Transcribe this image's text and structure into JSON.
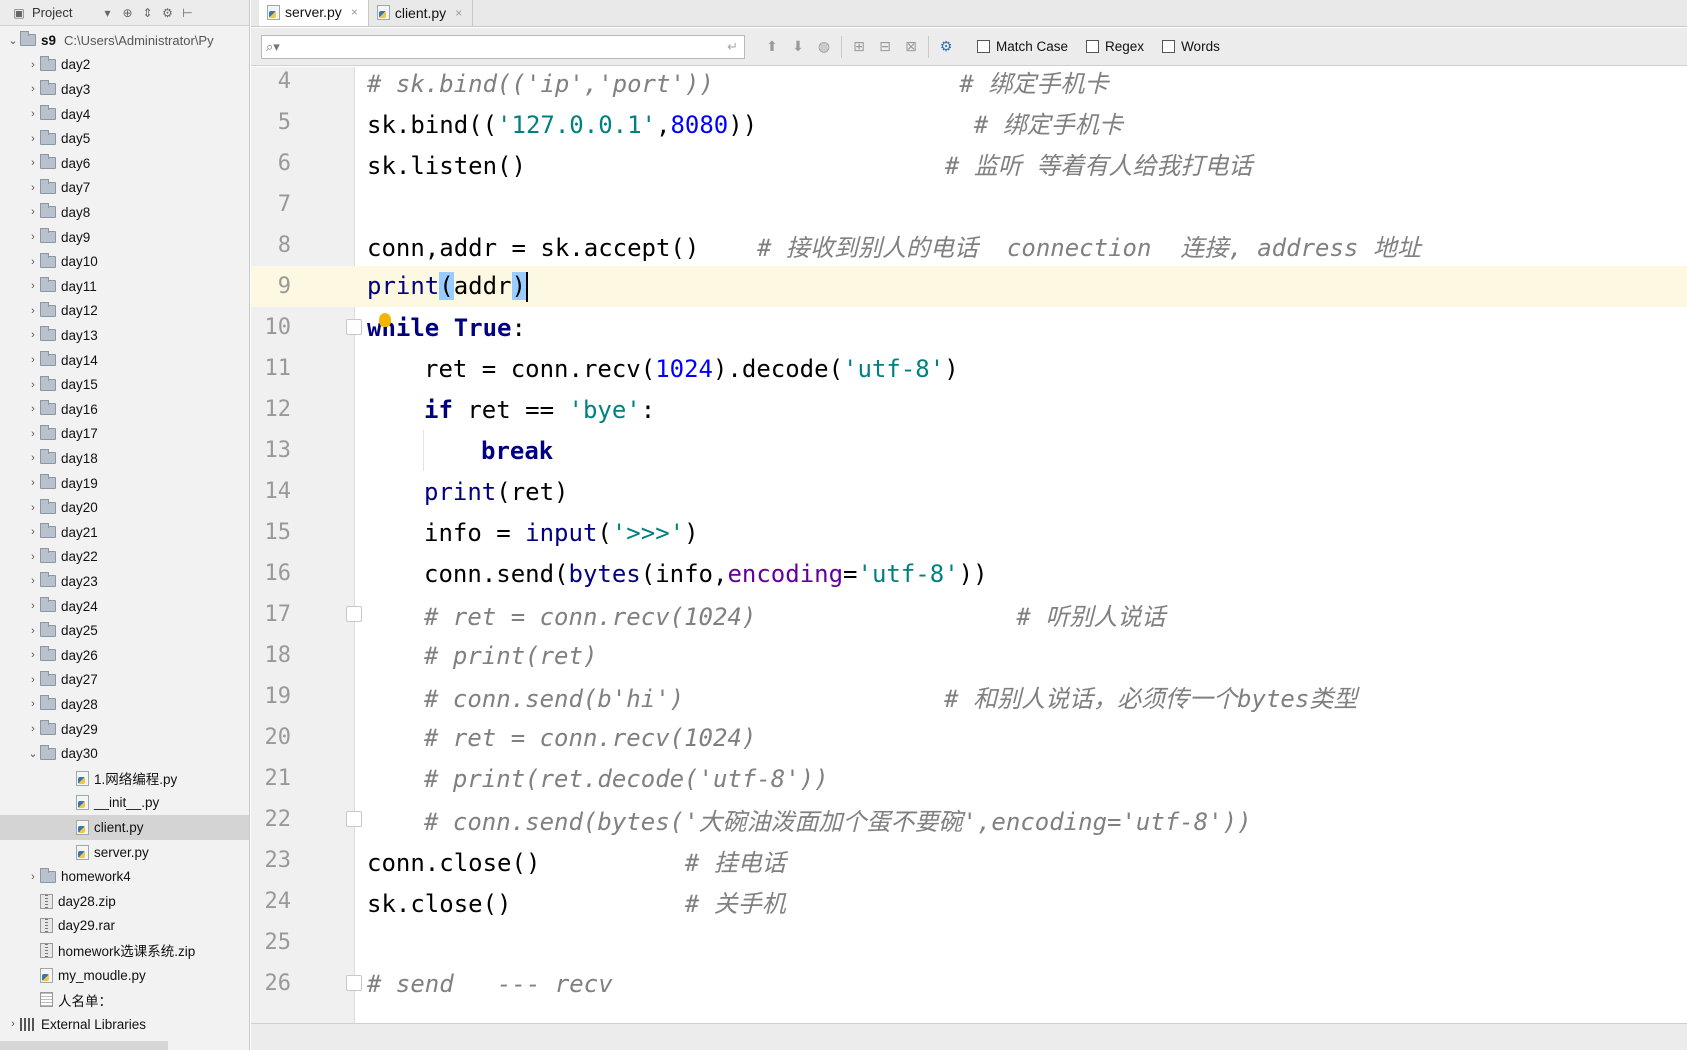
{
  "sidebar": {
    "toolbar": {
      "project_label": "Project"
    },
    "root": {
      "name": "s9",
      "path": "C:\\Users\\Administrator\\Py"
    },
    "days": [
      "day2",
      "day3",
      "day4",
      "day5",
      "day6",
      "day7",
      "day8",
      "day9",
      "day10",
      "day11",
      "day12",
      "day13",
      "day14",
      "day15",
      "day16",
      "day17",
      "day18",
      "day19",
      "day20",
      "day21",
      "day22",
      "day23",
      "day24",
      "day25",
      "day26",
      "day27",
      "day28",
      "day29"
    ],
    "day30": {
      "label": "day30",
      "children": [
        "1.网络编程.py",
        "__init__.py",
        "client.py",
        "server.py"
      ],
      "selected": "client.py"
    },
    "after": [
      {
        "label": "homework4",
        "kind": "folder"
      },
      {
        "label": "day28.zip",
        "kind": "zip"
      },
      {
        "label": "day29.rar",
        "kind": "zip"
      },
      {
        "label": "homework选课系统.zip",
        "kind": "zip"
      },
      {
        "label": "my_moudle.py",
        "kind": "py"
      },
      {
        "label": "人名单：",
        "kind": "txt"
      }
    ],
    "external": "External Libraries"
  },
  "tabs": [
    {
      "label": "server.py",
      "active": true
    },
    {
      "label": "client.py",
      "active": false
    }
  ],
  "findbar": {
    "placeholder": "",
    "options": [
      "Match Case",
      "Regex",
      "Words"
    ]
  },
  "editor": {
    "current_line": 9,
    "lines": [
      {
        "n": "4",
        "indent": 0,
        "html": "<span class='cm'># sk.bind(('ip','port'))                 # 绑定手机卡</span>"
      },
      {
        "n": "5",
        "indent": 0,
        "html": "sk.bind((<span class='str'>'127.0.0.1'</span>,<span class='num'>8080</span>))               <span class='cm'># 绑定手机卡</span>"
      },
      {
        "n": "6",
        "indent": 0,
        "html": "sk.listen()                             <span class='cm'># 监听 等着有人给我打电话</span>"
      },
      {
        "n": "7",
        "indent": 0,
        "html": ""
      },
      {
        "n": "8",
        "indent": 0,
        "html": "conn,addr = sk.accept()    <span class='cm'># 接收到别人的电话  connection  连接, address 地址</span>"
      },
      {
        "n": "9",
        "indent": 0,
        "html": "<span class='builtin'>print</span><span class='sel-par'>(</span>addr<span class='sel-par'>)</span><span class='caret'></span>"
      },
      {
        "n": "10",
        "indent": 0,
        "html": "<span class='kw'>while True</span>:"
      },
      {
        "n": "11",
        "indent": 1,
        "html": "ret = conn.recv(<span class='num'>1024</span>).decode(<span class='str'>'utf-8'</span>)"
      },
      {
        "n": "12",
        "indent": 1,
        "html": "<span class='kw'>if</span> ret == <span class='str'>'bye'</span>:"
      },
      {
        "n": "13",
        "indent": 2,
        "html": "<span class='kw'>break</span>"
      },
      {
        "n": "14",
        "indent": 1,
        "html": "<span class='builtin'>print</span>(ret)"
      },
      {
        "n": "15",
        "indent": 1,
        "html": "info = <span class='builtin'>input</span>(<span class='str'>'>>>'</span>)"
      },
      {
        "n": "16",
        "indent": 1,
        "html": "conn.send(<span class='builtin'>bytes</span>(info,<span class='param'>encoding</span>=<span class='str'>'utf-8'</span>))"
      },
      {
        "n": "17",
        "indent": 1,
        "html": "<span class='cm'># ret = conn.recv(1024)                  # 听别人说话</span>"
      },
      {
        "n": "18",
        "indent": 1,
        "html": "<span class='cm'># print(ret)</span>"
      },
      {
        "n": "19",
        "indent": 1,
        "html": "<span class='cm'># conn.send(b'hi')                  # 和别人说话，必须传一个bytes类型</span>"
      },
      {
        "n": "20",
        "indent": 1,
        "html": "<span class='cm'># ret = conn.recv(1024)</span>"
      },
      {
        "n": "21",
        "indent": 1,
        "html": "<span class='cm'># print(ret.decode('utf-8'))</span>"
      },
      {
        "n": "22",
        "indent": 1,
        "html": "<span class='cm'># conn.send(bytes('大碗油泼面加个蛋不要碗',encoding='utf-8'))</span>"
      },
      {
        "n": "23",
        "indent": 0,
        "html": "conn.close()          <span class='cm'># 挂电话</span>"
      },
      {
        "n": "24",
        "indent": 0,
        "html": "sk.close()            <span class='cm'># 关手机</span>"
      },
      {
        "n": "25",
        "indent": 0,
        "html": ""
      },
      {
        "n": "26",
        "indent": 0,
        "html": "<span class='cm'># send   --- recv</span>"
      }
    ]
  }
}
